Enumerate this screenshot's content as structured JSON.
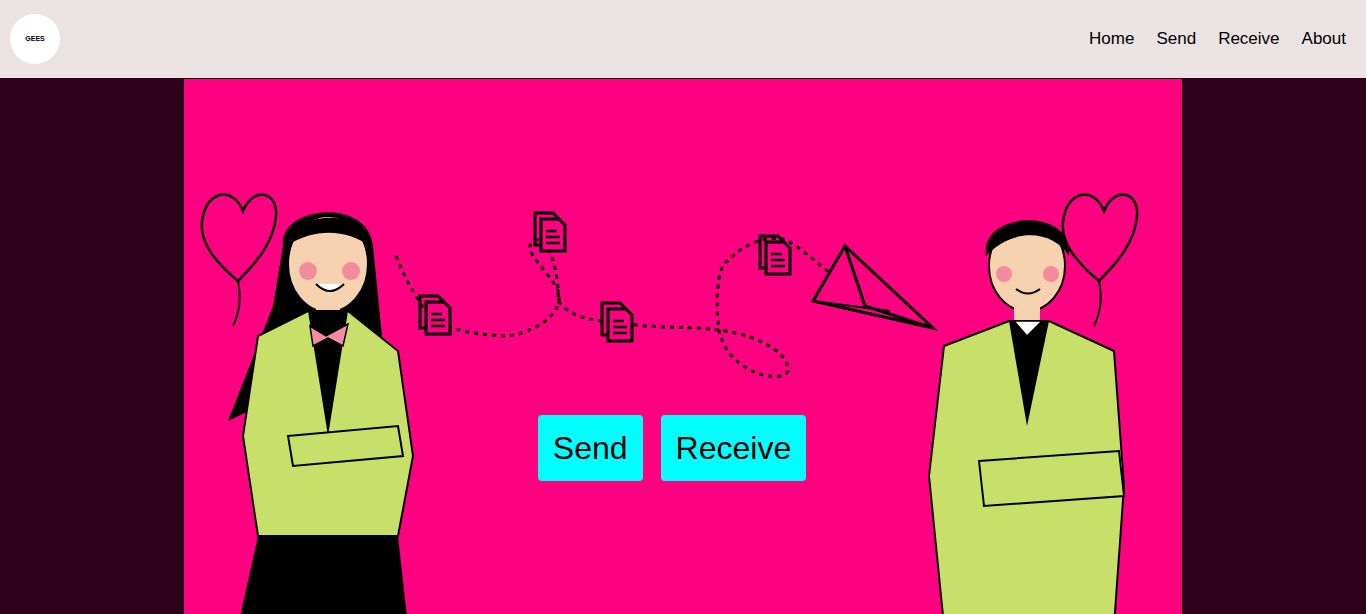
{
  "logo": {
    "text": "GEES"
  },
  "nav": [
    {
      "label": "Home"
    },
    {
      "label": "Send"
    },
    {
      "label": "Receive"
    },
    {
      "label": "About"
    }
  ],
  "hero": {
    "buttons": [
      {
        "label": "Send"
      },
      {
        "label": "Receive"
      }
    ]
  }
}
